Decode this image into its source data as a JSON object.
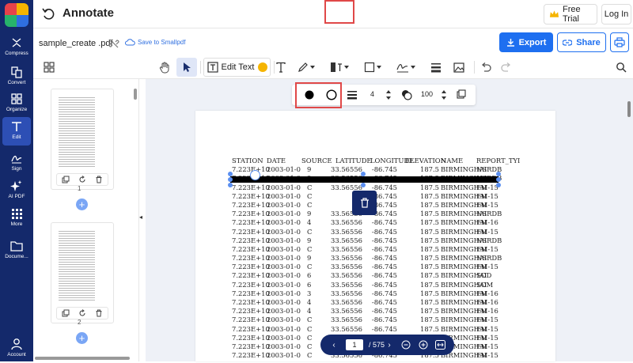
{
  "app": {
    "title": "Annotate",
    "free_trial": "Free Trial",
    "login": "Log In"
  },
  "rail": {
    "items": [
      {
        "label": "Compress",
        "icon": "compress-icon"
      },
      {
        "label": "Convert",
        "icon": "convert-icon"
      },
      {
        "label": "Organize",
        "icon": "organize-icon"
      },
      {
        "label": "Edit",
        "icon": "edit-text-icon",
        "active": true
      },
      {
        "label": "Sign",
        "icon": "sign-icon"
      },
      {
        "label": "AI PDF",
        "icon": "sparkle-icon"
      },
      {
        "label": "More",
        "icon": "grid-dots-icon"
      },
      {
        "label": "Docume...",
        "icon": "folder-icon"
      },
      {
        "label": "Account",
        "icon": "user-icon"
      }
    ]
  },
  "file": {
    "name": "sample_create .pdf",
    "save_link": "Save to Smallpdf"
  },
  "actions": {
    "export": "Export",
    "share": "Share"
  },
  "toolbar": {
    "edit_text": "Edit Text"
  },
  "props": {
    "stroke_width": "4",
    "opacity": "100"
  },
  "thumbnails": [
    {
      "page": "1"
    },
    {
      "page": "2"
    }
  ],
  "table": {
    "header": [
      "STATION",
      "DATE",
      "SOURCE",
      "LATITUDE",
      "LONGITUDE",
      "ELEVATION",
      "NAME",
      "REPORT_TYI"
    ],
    "rows": [
      [
        "7.223E+10",
        "2003-01-0",
        "9",
        "33.56556",
        "-86.745",
        "187.5",
        "BIRMINGHAI",
        "NSRDB"
      ],
      [
        "7.223E+10",
        "2003-01-0",
        "9",
        "33.56556",
        "-86.745",
        "187.5",
        "BIRMINGHAI",
        "NSRDB"
      ],
      [
        "7.223E+10",
        "2003-01-0",
        "C",
        "33.56556",
        "-86.745",
        "187.5",
        "BIRMINGHAI",
        "FM-15"
      ],
      [
        "7.223E+10",
        "2003-01-0",
        "C",
        "33.",
        "-86.745",
        "187.5",
        "BIRMINGHAI",
        "FM-15"
      ],
      [
        "7.223E+10",
        "2003-01-0",
        "C",
        "33.",
        "-86.745",
        "187.5",
        "BIRMINGHAI",
        "FM-15"
      ],
      [
        "7.223E+10",
        "2003-01-0",
        "9",
        "33.56556",
        "-86.745",
        "187.5",
        "BIRMINGHAI",
        "NSRDB"
      ],
      [
        "7.223E+10",
        "2003-01-0",
        "4",
        "33.56556",
        "-86.745",
        "187.5",
        "BIRMINGHAI",
        "FM-16"
      ],
      [
        "7.223E+10",
        "2003-01-0",
        "C",
        "33.56556",
        "-86.745",
        "187.5",
        "BIRMINGHAI",
        "FM-15"
      ],
      [
        "7.223E+10",
        "2003-01-0",
        "9",
        "33.56556",
        "-86.745",
        "187.5",
        "BIRMINGHAI",
        "NSRDB"
      ],
      [
        "7.223E+10",
        "2003-01-0",
        "C",
        "33.56556",
        "-86.745",
        "187.5",
        "BIRMINGHAI",
        "FM-15"
      ],
      [
        "7.223E+10",
        "2003-01-0",
        "9",
        "33.56556",
        "-86.745",
        "187.5",
        "BIRMINGHAI",
        "NSRDB"
      ],
      [
        "7.223E+10",
        "2003-01-0",
        "C",
        "33.56556",
        "-86.745",
        "187.5",
        "BIRMINGHAI",
        "FM-15"
      ],
      [
        "7.223E+10",
        "2003-01-0",
        "6",
        "33.56556",
        "-86.745",
        "187.5",
        "BIRMINGHAI",
        "SOD"
      ],
      [
        "7.223E+10",
        "2003-01-0",
        "6",
        "33.56556",
        "-86.745",
        "187.5",
        "BIRMINGHAI",
        "SOM"
      ],
      [
        "7.223E+10",
        "2003-01-0",
        "3",
        "33.56556",
        "-86.745",
        "187.5",
        "BIRMINGHAI",
        "FM-16"
      ],
      [
        "7.223E+10",
        "2003-01-0",
        "4",
        "33.56556",
        "-86.745",
        "187.5",
        "BIRMINGHAI",
        "FM-16"
      ],
      [
        "7.223E+10",
        "2003-01-0",
        "4",
        "33.56556",
        "-86.745",
        "187.5",
        "BIRMINGHAI",
        "FM-16"
      ],
      [
        "7.223E+10",
        "2003-01-0",
        "C",
        "33.56556",
        "-86.745",
        "187.5",
        "BIRMINGHAI",
        "FM-15"
      ],
      [
        "7.223E+10",
        "2003-01-0",
        "C",
        "33.56556",
        "-86.745",
        "187.5",
        "BIRMINGHAI",
        "FM-15"
      ],
      [
        "7.223E+10",
        "2003-01-0",
        "C",
        "33.56556",
        "-86.745",
        "187.5",
        "BIRMINGHAI",
        "FM-15"
      ],
      [
        "7.223E+10",
        "2003-01-0",
        "C",
        "33.56556",
        "-86.745",
        "187.5",
        "BIRMINGHAI",
        "FM-15"
      ],
      [
        "7.223E+10",
        "2003-01-0",
        "C",
        "33.56556",
        "-86.745",
        "187.5",
        "BIRMINGHAI",
        "FM-15"
      ]
    ]
  },
  "pager": {
    "current": "1",
    "total": "/ 575"
  },
  "colors": {
    "rail_bg": "#14296b",
    "accent": "#1e6ff0",
    "highlight": "#e04848"
  }
}
